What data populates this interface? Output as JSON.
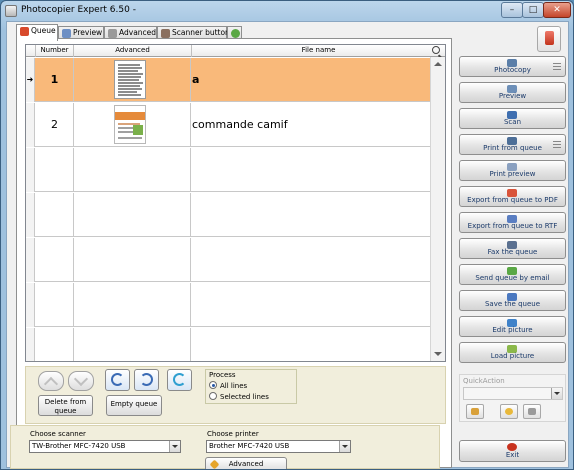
{
  "window": {
    "title": "Photocopier Expert 6.50 -"
  },
  "tabs": [
    {
      "label": "Queue",
      "icon": "queue-icon",
      "active": true
    },
    {
      "label": "Preview",
      "icon": "preview-icon",
      "active": false
    },
    {
      "label": "Advanced",
      "icon": "tools-icon",
      "active": false
    },
    {
      "label": "Scanner buttons",
      "icon": "scanner-buttons-icon",
      "active": false
    }
  ],
  "grid": {
    "columns": [
      "Number",
      "Advanced",
      "File name"
    ],
    "rows": [
      {
        "number": "1",
        "filename": "a",
        "selected": true
      },
      {
        "number": "2",
        "filename": "commande camif",
        "selected": false
      }
    ],
    "empty_rows": 5
  },
  "actions": {
    "delete_label": "Delete from queue",
    "empty_label": "Empty queue"
  },
  "process": {
    "legend": "Process",
    "options": [
      {
        "label": "All lines",
        "checked": true
      },
      {
        "label": "Selected lines",
        "checked": false
      }
    ]
  },
  "scanner": {
    "label": "Choose scanner",
    "value": "TW-Brother MFC-7420 USB"
  },
  "printer": {
    "label": "Choose printer",
    "value": "Brother MFC-7420 USB"
  },
  "advanced_button": "Advanced",
  "sidebar": {
    "buttons": [
      {
        "label": "Photocopy",
        "icon": "photocopy-icon",
        "grip": true,
        "color": "#5a7ea8"
      },
      {
        "label": "Preview",
        "icon": "eye-icon",
        "grip": false,
        "color": "#6d8fb8"
      },
      {
        "label": "Scan",
        "icon": "scan-icon",
        "grip": false,
        "color": "#3f6fb0"
      },
      {
        "label": "Print from queue",
        "icon": "printer-icon",
        "grip": true,
        "color": "#4d6f98"
      },
      {
        "label": "Print preview",
        "icon": "print-preview-icon",
        "grip": false,
        "color": "#8aa0c0"
      },
      {
        "label": "Export from queue to PDF",
        "icon": "pdf-icon",
        "grip": false,
        "color": "#d9543a"
      },
      {
        "label": "Export from queue to RTF",
        "icon": "rtf-icon",
        "grip": false,
        "color": "#5a7ec2"
      },
      {
        "label": "Fax the queue",
        "icon": "fax-icon",
        "grip": false,
        "color": "#5a7090"
      },
      {
        "label": "Send queue by email",
        "icon": "email-icon",
        "grip": false,
        "color": "#5aa845"
      },
      {
        "label": "Save the queue",
        "icon": "save-icon",
        "grip": false,
        "color": "#4a78c0"
      },
      {
        "label": "Edit picture",
        "icon": "edit-picture-icon",
        "grip": false,
        "color": "#3f82c9"
      },
      {
        "label": "Load picture",
        "icon": "load-picture-icon",
        "grip": false,
        "color": "#8bb84a"
      }
    ],
    "quick_action": {
      "label": "QuickAction",
      "value": ""
    },
    "exit_label": "Exit"
  }
}
